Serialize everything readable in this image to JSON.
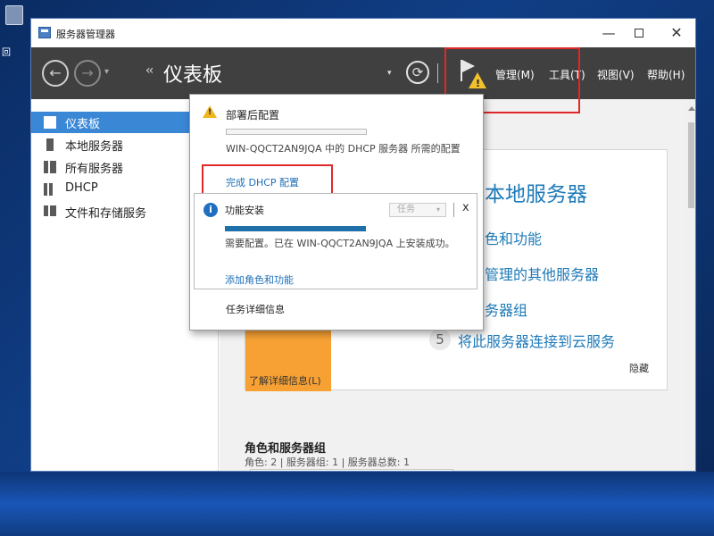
{
  "desktop": {
    "icon_label": "回"
  },
  "window": {
    "title": "服务器管理器",
    "min": "—",
    "close": "✕"
  },
  "header": {
    "back_glyph": "←",
    "fwd_glyph": "→",
    "nav_dropdown": "▾",
    "crumb_arrows": "‹‹",
    "breadcrumb": "仪表板",
    "drop_arrow": "▾",
    "refresh_glyph": "⟳",
    "menu": [
      "管理(M)",
      "工具(T)",
      "视图(V)",
      "帮助(H)"
    ]
  },
  "sidebar": {
    "items": [
      {
        "label": "仪表板",
        "icon": "dashboard-icon",
        "active": true
      },
      {
        "label": "本地服务器",
        "icon": "server-icon"
      },
      {
        "label": "所有服务器",
        "icon": "servers-icon"
      },
      {
        "label": "DHCP",
        "icon": "dhcp-icon"
      },
      {
        "label": "文件和存储服务",
        "icon": "storage-icon"
      }
    ]
  },
  "welcome": {
    "heading": "本地服务器",
    "steps": [
      {
        "text": "色和功能"
      },
      {
        "text": "管理的其他服务器"
      },
      {
        "text": "务器组"
      },
      {
        "num": "5",
        "text": "将此服务器连接到云服务"
      }
    ],
    "hide": "隐藏",
    "learn_more": "了解详细信息(L)"
  },
  "roles": {
    "title": "角色和服务器组",
    "subtitle": "角色: 2 | 服务器组: 1 | 服务器总数: 1"
  },
  "popup": {
    "post_deploy_title": "部署后配置",
    "post_deploy_desc": "WIN-QQCT2AN9JQA 中的 DHCP 服务器 所需的配置",
    "complete_dhcp_link": "完成 DHCP 配置",
    "feature": {
      "title": "功能安装",
      "task_label": "任务",
      "task_arrow": "▾",
      "close": "x",
      "message": "需要配置。已在 WIN-QQCT2AN9JQA 上安装成功。",
      "add_roles_link": "添加角色和功能"
    },
    "task_details": "任务详细信息"
  },
  "colors": {
    "header_bg": "#404040",
    "active_nav": "#3a87d6",
    "accent_blue": "#1e7ab9",
    "orange": "#f7a134",
    "highlight_red": "#e02828",
    "warning_yellow": "#f0b620"
  }
}
